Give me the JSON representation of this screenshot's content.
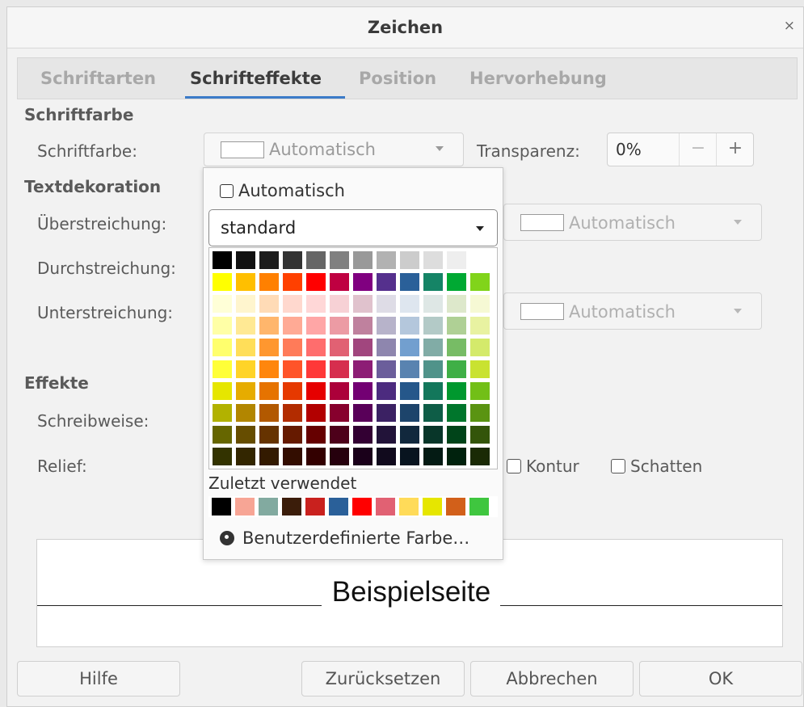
{
  "dialog": {
    "title": "Zeichen",
    "close_glyph": "×"
  },
  "tabs": [
    "Schriftarten",
    "Schrifteffekte",
    "Position",
    "Hervorhebung"
  ],
  "active_tab": "Schrifteffekte",
  "font_color": {
    "section": "Schriftfarbe",
    "label": "Schriftfarbe:",
    "value": "Automatisch",
    "transparency_label": "Transparenz:",
    "transparency_value": "0%",
    "minus": "−",
    "plus": "+"
  },
  "decoration": {
    "section": "Textdekoration",
    "overline_label": "Überstreichung:",
    "overline_color": "Automatisch",
    "strikethrough_label": "Durchstreichung:",
    "underline_label": "Unterstreichung:",
    "underline_color": "Automatisch"
  },
  "effects": {
    "section": "Effekte",
    "case_label": "Schreibweise:",
    "relief_label": "Relief:",
    "outline_label": "Kontur",
    "shadow_label": "Schatten"
  },
  "preview": {
    "text": "Beispielseite"
  },
  "buttons": {
    "help": "Hilfe",
    "reset": "Zurücksetzen",
    "cancel": "Abbrechen",
    "ok": "OK"
  },
  "color_popup": {
    "automatic_label": "Automatisch",
    "palette": "standard",
    "recent_label": "Zuletzt verwendet",
    "custom_label": "Benutzerdefinierte Farbe…",
    "grid": [
      [
        "#000000",
        "#111111",
        "#1c1c1c",
        "#333333",
        "#666666",
        "#808080",
        "#999999",
        "#b2b2b2",
        "#cccccc",
        "#dddddd",
        "#eeeeee",
        "#ffffff"
      ],
      [
        "#ffff00",
        "#ffbf00",
        "#ff8000",
        "#ff4000",
        "#ff0000",
        "#bf0041",
        "#800080",
        "#55308d",
        "#2a6099",
        "#158466",
        "#00a933",
        "#81d41a"
      ],
      [
        "#ffffd7",
        "#fff5ce",
        "#ffdbb6",
        "#ffd8ce",
        "#ffd7d7",
        "#f7d1d5",
        "#e0c2cd",
        "#dedce6",
        "#dee6ef",
        "#dee7e5",
        "#dde8cb",
        "#f6f9d4"
      ],
      [
        "#ffffa6",
        "#ffe994",
        "#ffb66c",
        "#ffaa95",
        "#ffa6a6",
        "#ec9ba4",
        "#bf819e",
        "#b7b3ca",
        "#b4c7dc",
        "#b3cac7",
        "#afd095",
        "#e8f2a1"
      ],
      [
        "#ffff6d",
        "#ffde59",
        "#ff972f",
        "#ff7b59",
        "#ff6d6d",
        "#e16173",
        "#a1467e",
        "#8e86ae",
        "#729fcf",
        "#81aca6",
        "#77bc65",
        "#d4ea6b"
      ],
      [
        "#ffff38",
        "#ffd428",
        "#ff860d",
        "#ff5429",
        "#ff3838",
        "#d62e4e",
        "#8d1d75",
        "#6b5e9b",
        "#5983b0",
        "#50938a",
        "#3faf46",
        "#c9e231"
      ],
      [
        "#e6e600",
        "#e6ac00",
        "#e67300",
        "#e63900",
        "#e60000",
        "#ac003a",
        "#730073",
        "#4c2b7f",
        "#25578a",
        "#13775b",
        "#00982e",
        "#72bf17"
      ],
      [
        "#b2b200",
        "#b28600",
        "#b25900",
        "#b22c00",
        "#b20000",
        "#87002d",
        "#590059",
        "#3b2163",
        "#1d446b",
        "#0e5d47",
        "#00762c",
        "#5a9412"
      ],
      [
        "#666600",
        "#664d00",
        "#663300",
        "#661a00",
        "#660000",
        "#4d001a",
        "#330033",
        "#221339",
        "#11283d",
        "#083629",
        "#004419",
        "#33550a"
      ],
      [
        "#333300",
        "#332600",
        "#331a00",
        "#330d00",
        "#330000",
        "#26000d",
        "#1a001a",
        "#110a1d",
        "#08141f",
        "#041b14",
        "#00220d",
        "#1a2a05"
      ]
    ],
    "recent": [
      "#000000",
      "#f7a595",
      "#82aaa0",
      "#3b1d0a",
      "#c9211e",
      "#2a6099",
      "#ff0000",
      "#e16173",
      "#ffdb59",
      "#e6e600",
      "#d2601a",
      "#3fc63f"
    ]
  }
}
